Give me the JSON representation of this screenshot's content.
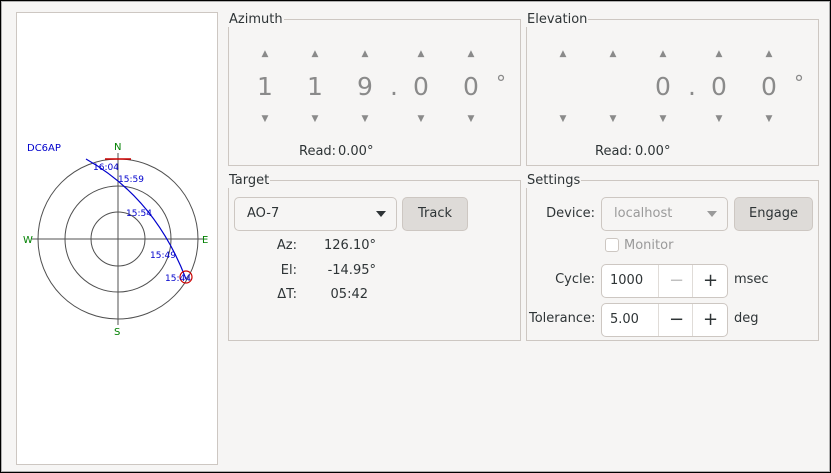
{
  "polar_plot": {
    "station": "DC6AP",
    "compass": {
      "n": "N",
      "s": "S",
      "e": "E",
      "w": "W"
    },
    "pass_times": [
      "16:04",
      "15:59",
      "15:54",
      "15:49",
      "15:44"
    ],
    "track_color": "#0000cc",
    "compass_color": "#008000",
    "station_color": "#0000cc",
    "marker_color": "#cc0000"
  },
  "azimuth": {
    "title": "Azimuth",
    "digits": [
      "1",
      "1",
      "9",
      ".",
      "0",
      "0",
      "°"
    ],
    "read_label": "Read:",
    "read_value": "0.00°"
  },
  "elevation": {
    "title": "Elevation",
    "digits": [
      "",
      "",
      "0",
      ".",
      "0",
      "0",
      "°"
    ],
    "read_label": "Read:",
    "read_value": "0.00°"
  },
  "target": {
    "title": "Target",
    "satellite": "AO-7",
    "track_button": "Track",
    "az_label": "Az:",
    "az_value": "126.10°",
    "el_label": "El:",
    "el_value": "-14.95°",
    "dt_label": "ΔT:",
    "dt_value": "05:42"
  },
  "settings": {
    "title": "Settings",
    "device_label": "Device:",
    "device_value": "localhost",
    "engage_button": "Engage",
    "monitor_label": "Monitor",
    "monitor_checked": false,
    "cycle_label": "Cycle:",
    "cycle_value": "1000",
    "cycle_unit": "msec",
    "tolerance_label": "Tolerance:",
    "tolerance_value": "5.00",
    "tolerance_unit": "deg",
    "minus_glyph": "−",
    "plus_glyph": "+"
  }
}
